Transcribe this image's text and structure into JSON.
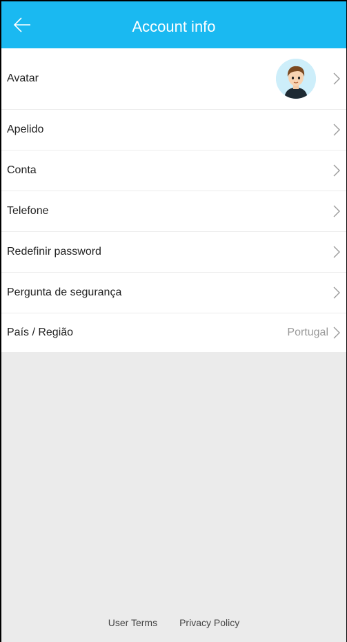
{
  "header": {
    "title": "Account info",
    "back_icon": "back-arrow-icon",
    "background_color": "#1ab9f1"
  },
  "rows": [
    {
      "label": "Avatar",
      "value": ""
    },
    {
      "label": "Apelido",
      "value": ""
    },
    {
      "label": "Conta",
      "value": ""
    },
    {
      "label": "Telefone",
      "value": ""
    },
    {
      "label": "Redefinir password",
      "value": ""
    },
    {
      "label": "Pergunta de segurança",
      "value": ""
    },
    {
      "label": "País / Região",
      "value": "Portugal"
    }
  ],
  "footer": {
    "user_terms": "User Terms",
    "privacy_policy": "Privacy Policy"
  }
}
